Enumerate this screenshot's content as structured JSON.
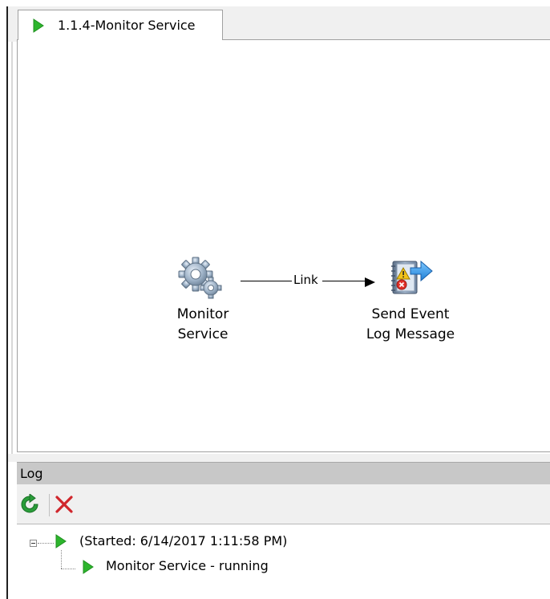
{
  "tab": {
    "title": "1.1.4-Monitor Service",
    "icon": "play-icon"
  },
  "workflow": {
    "nodes": [
      {
        "label_line1": "Monitor",
        "label_line2": "Service",
        "icon": "gear-icon"
      },
      {
        "label_line1": "Send Event",
        "label_line2": "Log Message",
        "icon": "event-log-icon"
      }
    ],
    "link_label": "Link"
  },
  "log": {
    "header": "Log",
    "toolbar": {
      "refresh_icon": "refresh-icon",
      "clear_icon": "delete-icon"
    },
    "entries": [
      {
        "text": "(Started: 6/14/2017 1:11:58 PM)",
        "icon": "play-icon"
      },
      {
        "text": "Monitor Service - running",
        "icon": "play-icon"
      }
    ]
  },
  "colors": {
    "play_green": "#2db52d",
    "delete_red": "#d0262c",
    "refresh_green": "#2a9d3a"
  }
}
